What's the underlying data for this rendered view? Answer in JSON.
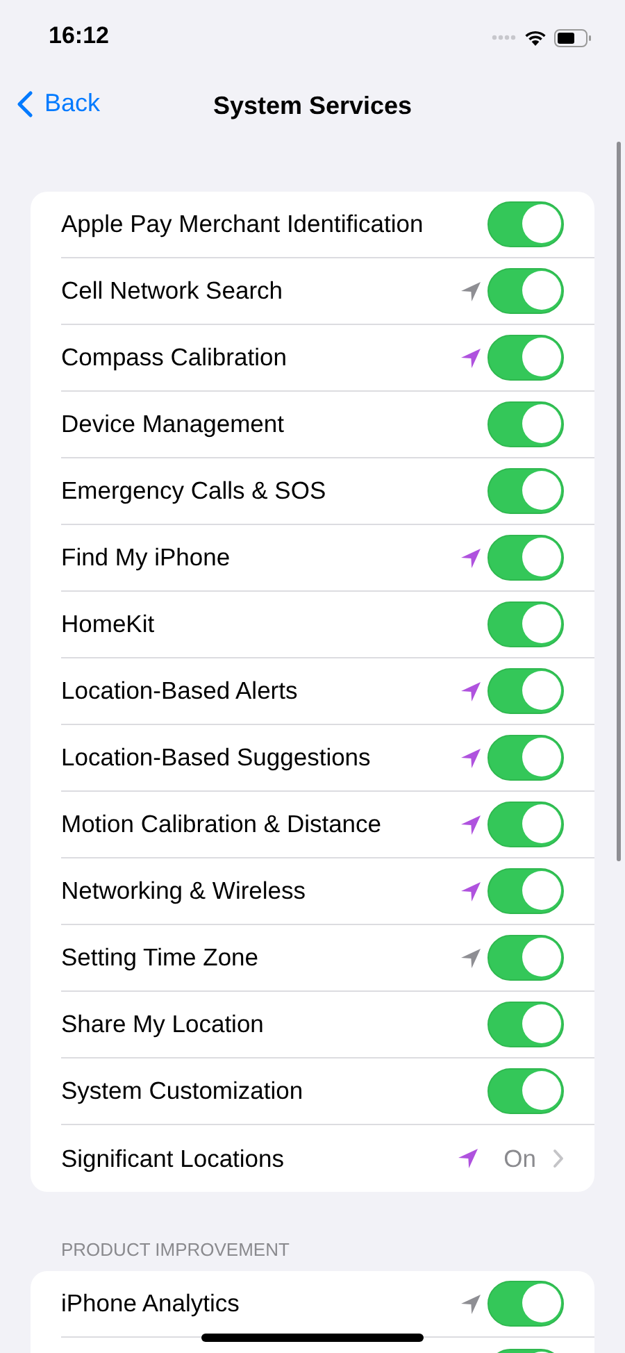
{
  "status_bar": {
    "time": "16:12"
  },
  "nav": {
    "back": "Back",
    "title": "System Services"
  },
  "sections": [
    {
      "items": [
        {
          "kind": "toggle",
          "label": "Apple Pay Merchant Identification",
          "on": true
        },
        {
          "kind": "toggle",
          "label": "Cell Network Search",
          "on": true,
          "color": "#8e8e93"
        },
        {
          "kind": "toggle",
          "label": "Compass Calibration",
          "on": true,
          "color": "#af52de"
        },
        {
          "kind": "toggle",
          "label": "Device Management",
          "on": true
        },
        {
          "kind": "toggle",
          "label": "Emergency Calls & SOS",
          "on": true
        },
        {
          "kind": "toggle",
          "label": "Find My iPhone",
          "on": true,
          "color": "#af52de"
        },
        {
          "kind": "toggle",
          "label": "HomeKit",
          "on": true
        },
        {
          "kind": "toggle",
          "label": "Location-Based Alerts",
          "on": true,
          "color": "#af52de"
        },
        {
          "kind": "toggle",
          "label": "Location-Based Suggestions",
          "on": true,
          "color": "#af52de"
        },
        {
          "kind": "toggle",
          "label": "Motion Calibration & Distance",
          "on": true,
          "color": "#af52de"
        },
        {
          "kind": "toggle",
          "label": "Networking & Wireless",
          "on": true,
          "color": "#af52de"
        },
        {
          "kind": "toggle",
          "label": "Setting Time Zone",
          "on": true,
          "color": "#8e8e93"
        },
        {
          "kind": "toggle",
          "label": "Share My Location",
          "on": true
        },
        {
          "kind": "toggle",
          "label": "System Customization",
          "on": true
        },
        {
          "kind": "link",
          "label": "Significant Locations",
          "value": "On",
          "color": "#af52de"
        }
      ]
    },
    {
      "header": "PRODUCT IMPROVEMENT",
      "items": [
        {
          "kind": "toggle",
          "label": "iPhone Analytics",
          "on": true,
          "color": "#8e8e93"
        },
        {
          "kind": "toggle",
          "on": true
        }
      ]
    }
  ]
}
